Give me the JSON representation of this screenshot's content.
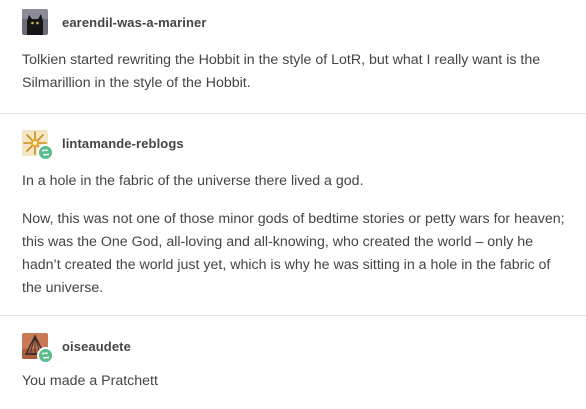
{
  "posts": [
    {
      "username": "earendil-was-a-mariner",
      "avatar_icon": "black-cat-avatar-icon",
      "paragraphs": [
        "Tolkien started rewriting the Hobbit in the style of LotR, but what I really want is the Silmarillion in the style of the Hobbit."
      ]
    },
    {
      "username": "lintamande-reblogs",
      "avatar_icon": "golden-star-avatar-icon",
      "reblog_badge_icon": "reblog-arrows-icon",
      "paragraphs": [
        "In a hole in the fabric of the universe there lived a god.",
        "Now, this was not one of those minor gods of bedtime stories or petty wars for heaven; this was the One God, all-loving and all-knowing, who created the world – only he hadn’t created the world just yet, which is why he was sitting in a hole in the fabric of the universe."
      ]
    },
    {
      "username": "oiseaudete",
      "avatar_icon": "geometric-tent-avatar-icon",
      "reblog_badge_icon": "reblog-arrows-icon",
      "paragraphs": [
        "You made a Pratchett"
      ]
    }
  ],
  "colors": {
    "text": "#444444",
    "divider": "#e6e6e6",
    "reblog_badge": "#56bc8a"
  }
}
